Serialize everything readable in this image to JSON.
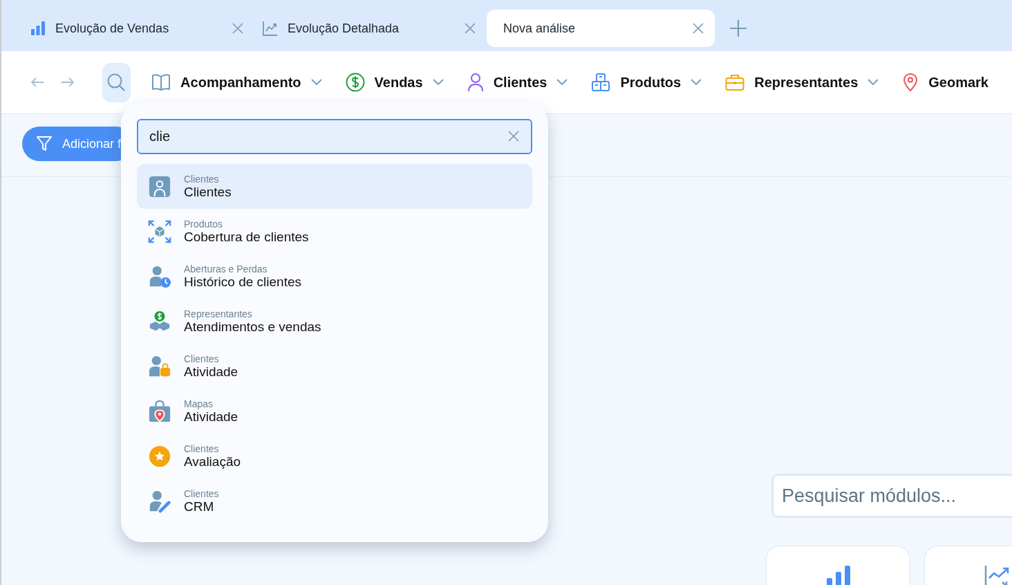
{
  "tabs": [
    {
      "label": "Evolução de Vendas",
      "selected": false
    },
    {
      "label": "Evolução Detalhada",
      "selected": false
    },
    {
      "label": "Nova análise",
      "selected": true
    }
  ],
  "nav": {
    "items": [
      {
        "label": "Acompanhamento",
        "menu": true
      },
      {
        "label": "Vendas",
        "menu": true
      },
      {
        "label": "Clientes",
        "menu": true
      },
      {
        "label": "Produtos",
        "menu": true
      },
      {
        "label": "Representantes",
        "menu": true
      },
      {
        "label": "Geomark",
        "menu": false
      }
    ]
  },
  "filter_button": {
    "label": "Adicionar f"
  },
  "search": {
    "value": "clie"
  },
  "results": [
    {
      "category": "Clientes",
      "title": "Clientes",
      "selected": true
    },
    {
      "category": "Produtos",
      "title": "Cobertura de clientes",
      "selected": false
    },
    {
      "category": "Aberturas e Perdas",
      "title": "Histórico de clientes",
      "selected": false
    },
    {
      "category": "Representantes",
      "title": "Atendimentos e vendas",
      "selected": false
    },
    {
      "category": "Clientes",
      "title": "Atividade",
      "selected": false
    },
    {
      "category": "Mapas",
      "title": "Atividade",
      "selected": false
    },
    {
      "category": "Clientes",
      "title": "Avaliação",
      "selected": false
    },
    {
      "category": "Clientes",
      "title": "CRM",
      "selected": false
    }
  ],
  "module_search": {
    "placeholder": "Pesquisar módulos..."
  },
  "module_cards": [
    {
      "kind": "bar-chart"
    },
    {
      "kind": "line-chart"
    }
  ]
}
